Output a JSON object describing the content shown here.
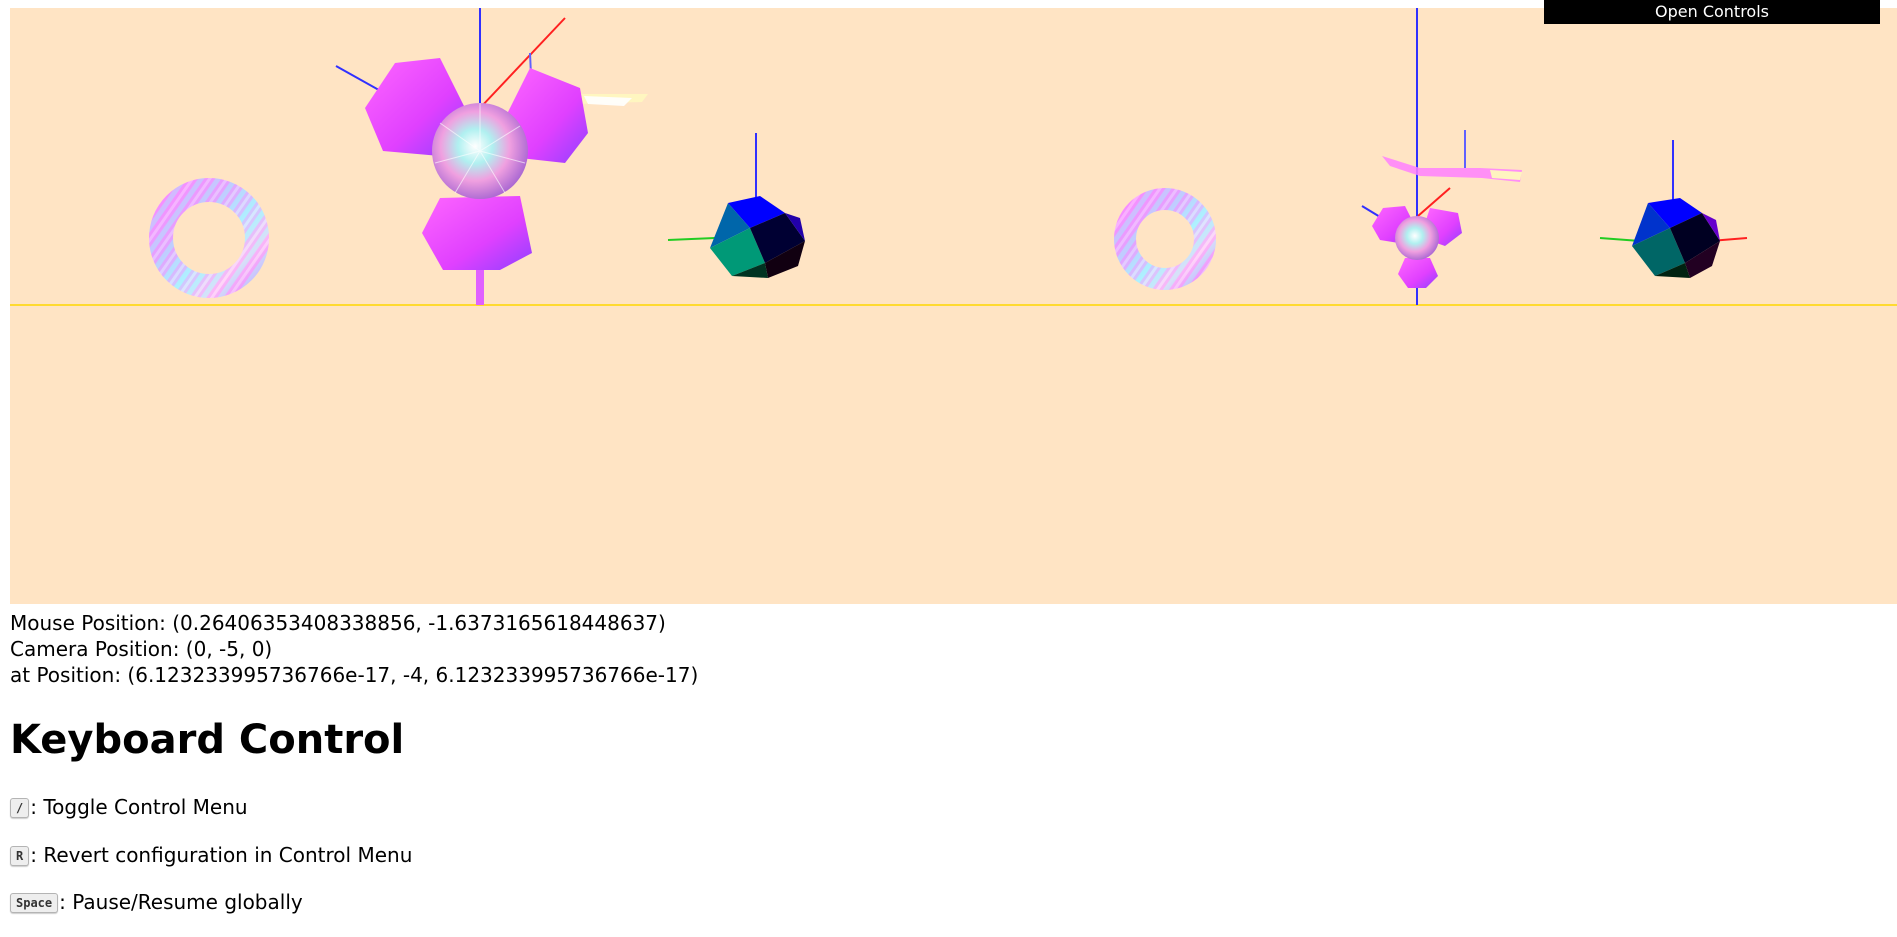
{
  "controls_button": {
    "label": "Open Controls"
  },
  "readouts": {
    "mouse": "Mouse Position: (0.26406353408338856, -1.6373165618448637)",
    "camera": "Camera Position: (0, -5, 0)",
    "at": "at Position: (6.123233995736766e-17, -4, 6.123233995736766e-17)"
  },
  "keyboard": {
    "title": "Keyboard Control",
    "items": [
      {
        "key": "/",
        "desc": ": Toggle Control Menu"
      },
      {
        "key": "R",
        "desc": ": Revert configuration in Control Menu"
      },
      {
        "key": "Space",
        "desc": ": Pause/Resume globally"
      }
    ]
  },
  "colors": {
    "viewport_background": "#ffe4c4",
    "horizon_line": "#ffd700",
    "axis_x": "#ff0000",
    "axis_y": "#00cc00",
    "axis_z": "#0000ff",
    "controls_button_bg": "#000000",
    "controls_button_text": "#ffffff"
  },
  "scene": {
    "objects": [
      {
        "name": "torus-left",
        "shape": "torus"
      },
      {
        "name": "tripetal-left",
        "shape": "three-petal propeller with cone hub"
      },
      {
        "name": "icosahedron-left",
        "shape": "icosahedron"
      },
      {
        "name": "torus-right",
        "shape": "torus"
      },
      {
        "name": "tripetal-right",
        "shape": "three-petal propeller with cone hub"
      },
      {
        "name": "icosahedron-right",
        "shape": "icosahedron"
      }
    ]
  }
}
